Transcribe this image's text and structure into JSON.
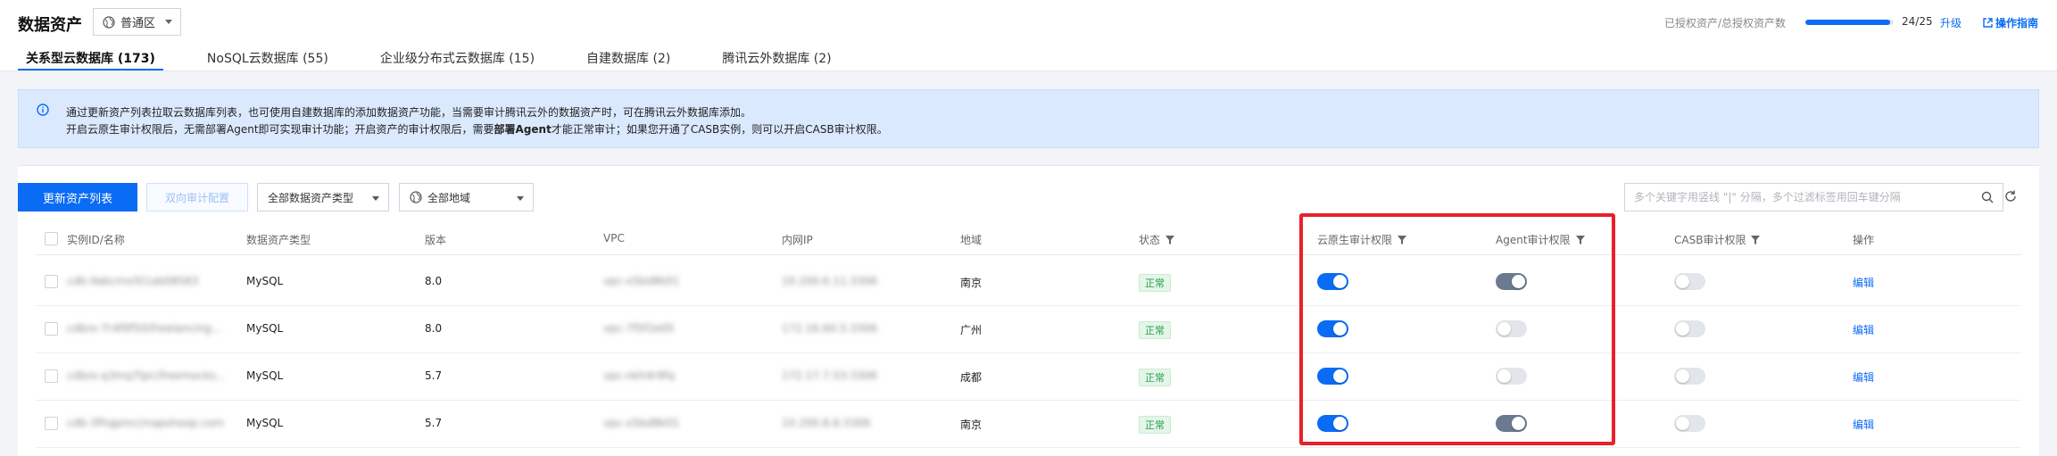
{
  "header": {
    "title": "数据资产",
    "region": "普通区",
    "quota_label": "已授权资产/总授权资产数",
    "quota_value": "24/25",
    "quota_fraction": 0.96,
    "upgrade": "升级",
    "guide": "操作指南"
  },
  "tabs": [
    {
      "label": "关系型云数据库 (173)",
      "active": true
    },
    {
      "label": "NoSQL云数据库 (55)",
      "active": false
    },
    {
      "label": "企业级分布式云数据库 (15)",
      "active": false
    },
    {
      "label": "自建数据库 (2)",
      "active": false
    },
    {
      "label": "腾讯云外数据库 (2)",
      "active": false
    }
  ],
  "info": {
    "line1": "通过更新资产列表拉取云数据库列表，也可使用自建数据库的添加数据资产功能，当需要审计腾讯云外的数据资产时，可在腾讯云外数据库添加。",
    "line2_a": "开启云原生审计权限后，无需部署Agent即可实现审计功能；开启资产的审计权限后，需要",
    "line2_b": "部署Agent",
    "line2_c": "才能正常审计；如果您开通了CASB实例，则可以开启CASB审计权限。"
  },
  "toolbar": {
    "update_btn": "更新资产列表",
    "bidir_btn": "双向审计配置",
    "type_select": "全部数据资产类型",
    "region_select": "全部地域",
    "search_placeholder": "多个关键字用竖线 \"|\" 分隔，多个过滤标签用回车键分隔"
  },
  "columns": {
    "id": "实例ID/名称",
    "type": "数据资产类型",
    "version": "版本",
    "vpc": "VPC",
    "ip": "内网IP",
    "region": "地域",
    "status": "状态",
    "native": "云原生审计权限",
    "agent": "Agent审计权限",
    "casb": "CASB审计权限",
    "action": "操作"
  },
  "rows": [
    {
      "id": "cdb-9abcmx5t1ab08583",
      "type": "MySQL",
      "version": "8.0",
      "vpc": "vpc-x5bd8k01",
      "ip": "10.200.6.11:3306",
      "region": "南京",
      "status": "正常",
      "native": true,
      "agent": true,
      "casb": false,
      "action": "编辑"
    },
    {
      "id": "cdbro-7r4f0f50(freelancing...",
      "type": "MySQL",
      "version": "8.0",
      "vpc": "vpc-7f5f2e05",
      "ip": "172.16.60.5:3306",
      "region": "广州",
      "status": "正常",
      "native": true,
      "agent": false,
      "casb": false,
      "action": "编辑"
    },
    {
      "id": "cdbro-q3mq7tpc(freemocks...",
      "type": "MySQL",
      "version": "5.7",
      "vpc": "vpc-nkh4r9fq",
      "ip": "172.17.7.53:3306",
      "region": "成都",
      "status": "正常",
      "native": true,
      "agent": false,
      "casb": false,
      "action": "编辑"
    },
    {
      "id": "cdb-3fhqpmc(mapshoop.com",
      "type": "MySQL",
      "version": "5.7",
      "vpc": "vpc-x5bd8k01",
      "ip": "10.200.8.6:3306",
      "region": "南京",
      "status": "正常",
      "native": true,
      "agent": true,
      "casb": false,
      "action": "编辑"
    }
  ]
}
